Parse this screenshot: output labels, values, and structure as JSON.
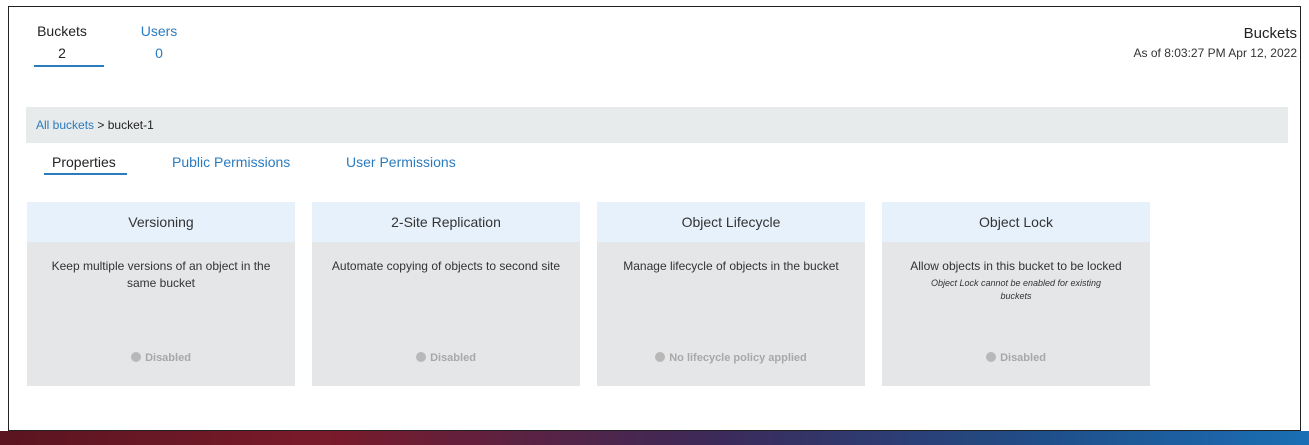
{
  "top_tabs": [
    {
      "label": "Buckets",
      "count": "2"
    },
    {
      "label": "Users",
      "count": "0"
    }
  ],
  "header": {
    "title": "Buckets",
    "as_of": "As of 8:03:27 PM Apr 12, 2022"
  },
  "breadcrumb": {
    "link": "All buckets",
    "separator": " > ",
    "current": "bucket-1"
  },
  "sub_tabs": [
    {
      "label": "Properties"
    },
    {
      "label": "Public Permissions"
    },
    {
      "label": "User Permissions"
    }
  ],
  "cards": [
    {
      "title": "Versioning",
      "description": "Keep multiple versions of an object in the same bucket",
      "status": "Disabled"
    },
    {
      "title": "2-Site Replication",
      "description": "Automate copying of objects to second site",
      "status": "Disabled"
    },
    {
      "title": "Object Lifecycle",
      "description": "Manage lifecycle of objects in the bucket",
      "status": "No lifecycle policy applied"
    },
    {
      "title": "Object Lock",
      "description": "Allow objects in this bucket to be locked",
      "note": "Object Lock cannot be enabled for existing buckets",
      "status": "Disabled"
    }
  ],
  "colors": {
    "accent": "#2b7bbf",
    "card_header": "#e7f1fb",
    "card_body": "#e4e6e7",
    "status_disabled": "#a8a8a8"
  }
}
